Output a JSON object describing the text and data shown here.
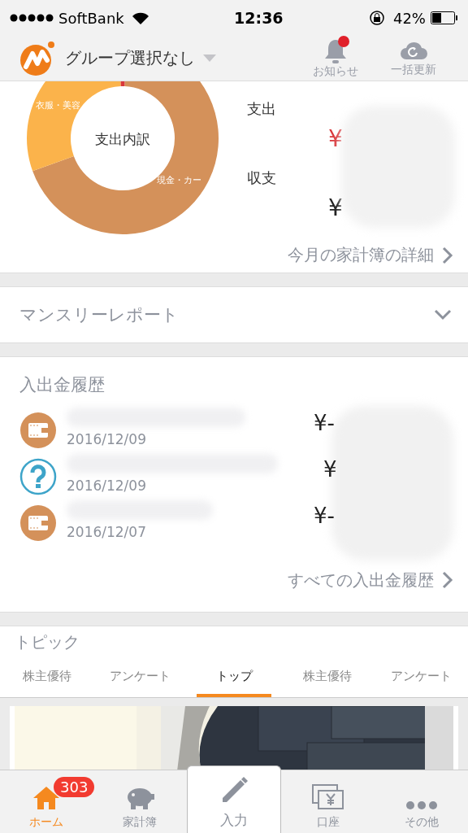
{
  "status_bar": {
    "carrier": "SoftBank",
    "time": "12:36",
    "battery": "42%"
  },
  "header": {
    "group_selector": "グループ選択なし",
    "actions": [
      {
        "kind": "bell",
        "label": "お知らせ",
        "badge": true
      },
      {
        "kind": "refresh",
        "label": "一括更新",
        "badge": false
      }
    ]
  },
  "summary": {
    "donut_center": "支出内訳",
    "slice_labels": [
      "衣服・美容",
      "現金・カー"
    ],
    "rows": [
      {
        "kind": "expense",
        "label": "支出",
        "amount": "¥"
      },
      {
        "kind": "balance",
        "label": "収支",
        "amount": "¥"
      }
    ],
    "link": "今月の家計簿の詳細"
  },
  "monthly_report": {
    "title": "マンスリーレポート",
    "expanded": false
  },
  "history": {
    "title": "入出金履歴",
    "items": [
      {
        "kind": "wallet",
        "date": "2016/12/09",
        "amount": "¥-"
      },
      {
        "kind": "unknown",
        "date": "2016/12/09",
        "amount": "¥"
      },
      {
        "kind": "wallet",
        "date": "2016/12/07",
        "amount": "¥-"
      }
    ],
    "link": "すべての入出金履歴"
  },
  "topics": {
    "title": "トピック",
    "tabs": [
      {
        "label": "株主優待",
        "selected": false
      },
      {
        "label": "アンケート",
        "selected": false
      },
      {
        "label": "トップ",
        "selected": true
      },
      {
        "label": "株主優待",
        "selected": false
      },
      {
        "label": "アンケート",
        "selected": false
      }
    ]
  },
  "tab_bar": [
    {
      "label": "ホーム",
      "selected": true,
      "badge": "303"
    },
    {
      "label": "家計簿",
      "selected": false
    },
    {
      "label": "入力",
      "selected": false
    },
    {
      "label": "口座",
      "selected": false
    },
    {
      "label": "その他",
      "selected": false
    }
  ]
}
